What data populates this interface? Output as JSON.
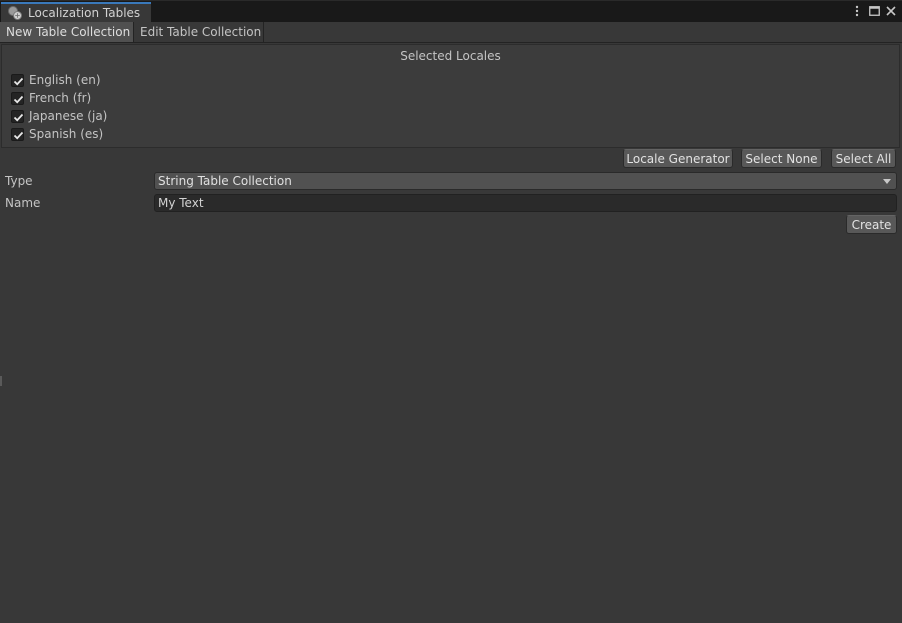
{
  "window": {
    "title": "Localization Tables",
    "controls": [
      "more-options-icon",
      "maximize-icon",
      "close-icon"
    ]
  },
  "toolbar": {
    "tabs": [
      {
        "label": "New Table Collection",
        "active": true
      },
      {
        "label": "Edit Table Collection",
        "active": false
      }
    ]
  },
  "locales": {
    "heading": "Selected Locales",
    "items": [
      {
        "label": "English (en)",
        "checked": true
      },
      {
        "label": "French (fr)",
        "checked": true
      },
      {
        "label": "Japanese (ja)",
        "checked": true
      },
      {
        "label": "Spanish (es)",
        "checked": true
      }
    ],
    "buttons": {
      "locale_generator": "Locale Generator",
      "select_none": "Select None",
      "select_all": "Select All"
    }
  },
  "form": {
    "type_label": "Type",
    "type_value": "String Table Collection",
    "name_label": "Name",
    "name_value": "My Text",
    "create_label": "Create"
  },
  "colors": {
    "accent": "#3a79bb",
    "background": "#383838",
    "titlebar": "#191919"
  }
}
